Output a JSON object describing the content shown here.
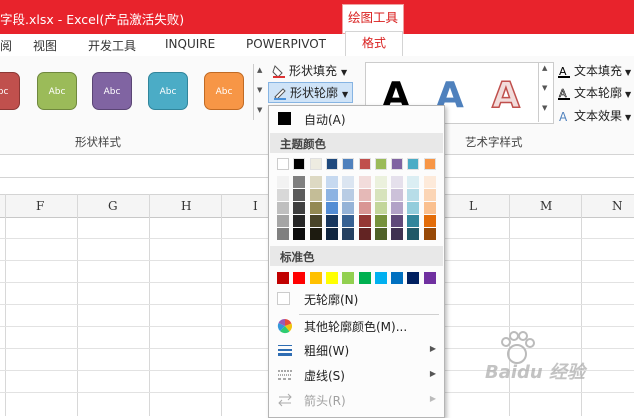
{
  "titlebar": {
    "text": "字段.xlsx -   Excel(产品激活失败)",
    "context_tab": "绘图工具"
  },
  "tabs": [
    {
      "label": "阅"
    },
    {
      "label": "视图"
    },
    {
      "label": "开发工具"
    },
    {
      "label": "INQUIRE"
    },
    {
      "label": "POWERPIVOT"
    },
    {
      "label": "格式",
      "active": true
    }
  ],
  "ribbon": {
    "shape_styles": {
      "swatches": [
        {
          "label": "Abc",
          "color": "#c0504d"
        },
        {
          "label": "Abc",
          "color": "#9bbb59"
        },
        {
          "label": "Abc",
          "color": "#8064a2"
        },
        {
          "label": "Abc",
          "color": "#4bacc6"
        },
        {
          "label": "Abc",
          "color": "#f79646"
        }
      ],
      "group_label": "形状样式"
    },
    "shape_fill": "形状填充",
    "shape_outline": "形状轮廓",
    "wordart": {
      "samples": [
        {
          "glyph": "A",
          "color": "#000000"
        },
        {
          "glyph": "A",
          "color": "#4f81bd"
        },
        {
          "glyph": "A",
          "color": "#f2dcdb"
        }
      ],
      "group_label": "艺术字样式"
    },
    "text_fill": "文本填充",
    "text_outline": "文本轮廓",
    "text_effect": "文本效果"
  },
  "columns": [
    "F",
    "G",
    "H",
    "I",
    "L",
    "M",
    "N"
  ],
  "menu": {
    "auto": "自动(A)",
    "theme_colors_label": "主题颜色",
    "theme_top": [
      "#ffffff",
      "#000000",
      "#eeece1",
      "#1f497d",
      "#4f81bd",
      "#c0504d",
      "#9bbb59",
      "#8064a2",
      "#4bacc6",
      "#f79646"
    ],
    "theme_shades": [
      [
        "#f2f2f2",
        "#7f7f7f",
        "#ddd9c3",
        "#c6d9f0",
        "#dbe5f1",
        "#f2dcdb",
        "#ebf1dd",
        "#e5e0ec",
        "#dbeef3",
        "#fdeada"
      ],
      [
        "#d8d8d8",
        "#595959",
        "#c4bd97",
        "#8db3e2",
        "#b8cce4",
        "#e5b9b7",
        "#d7e3bc",
        "#ccc1d9",
        "#b7dde8",
        "#fbd5b5"
      ],
      [
        "#bfbfbf",
        "#3f3f3f",
        "#938953",
        "#548dd4",
        "#95b3d7",
        "#d99694",
        "#c3d69b",
        "#b2a2c7",
        "#92cddc",
        "#fac08f"
      ],
      [
        "#a5a5a5",
        "#262626",
        "#494429",
        "#17365d",
        "#366092",
        "#953734",
        "#76923c",
        "#5f497a",
        "#31859b",
        "#e36c09"
      ],
      [
        "#7f7f7f",
        "#0c0c0c",
        "#1d1b10",
        "#0f243e",
        "#244061",
        "#632423",
        "#4f6128",
        "#3f3151",
        "#205867",
        "#974806"
      ]
    ],
    "standard_colors_label": "标准色",
    "standard_colors": [
      "#c00000",
      "#ff0000",
      "#ffc000",
      "#ffff00",
      "#92d050",
      "#00b050",
      "#00b0f0",
      "#0070c0",
      "#002060",
      "#7030a0"
    ],
    "no_outline": "无轮廓(N)",
    "more_colors": "其他轮廓颜色(M)...",
    "weight": "粗细(W)",
    "dashes": "虚线(S)",
    "arrows": "箭头(R)"
  },
  "watermark": "Baidu 经验"
}
